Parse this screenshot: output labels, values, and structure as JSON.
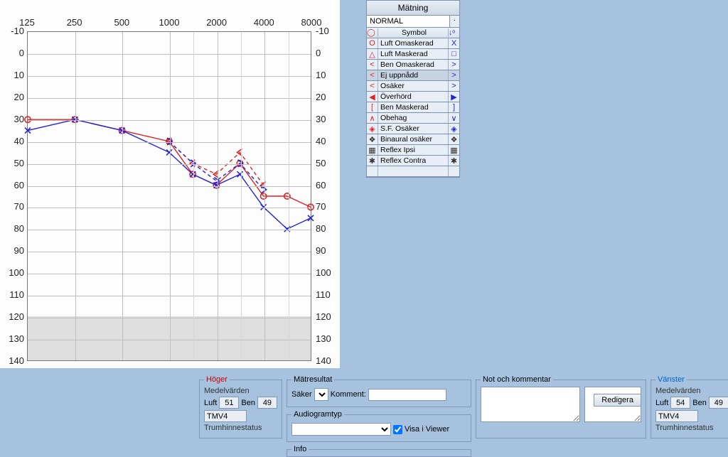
{
  "chart_data": {
    "type": "line",
    "xlabel": "",
    "ylabel": "",
    "x_categories": [
      125,
      250,
      500,
      1000,
      2000,
      4000,
      8000
    ],
    "x_extra_ticks": [
      1500,
      3000,
      6000
    ],
    "y_ticks": [
      -10,
      0,
      10,
      20,
      30,
      40,
      50,
      60,
      70,
      80,
      90,
      100,
      110,
      120,
      130,
      140
    ],
    "ylim": [
      -10,
      140
    ],
    "shaded_from_y": 120,
    "series": [
      {
        "name": "right-air",
        "color": "#d22",
        "marker": "O",
        "points": [
          [
            125,
            30
          ],
          [
            250,
            30
          ],
          [
            500,
            35
          ],
          [
            1000,
            40
          ],
          [
            1500,
            55
          ],
          [
            2000,
            60
          ],
          [
            3000,
            50
          ],
          [
            4000,
            65
          ],
          [
            6000,
            65
          ],
          [
            8000,
            70
          ]
        ]
      },
      {
        "name": "left-air",
        "color": "#22d",
        "marker": "X",
        "points": [
          [
            125,
            35
          ],
          [
            250,
            30
          ],
          [
            500,
            35
          ],
          [
            1000,
            45
          ],
          [
            1500,
            55
          ],
          [
            2000,
            60
          ],
          [
            3000,
            55
          ],
          [
            4000,
            70
          ],
          [
            6000,
            80
          ],
          [
            8000,
            75
          ]
        ]
      },
      {
        "name": "right-bone",
        "color": "#d22",
        "marker": "<",
        "dashed": true,
        "points": [
          [
            1000,
            40
          ],
          [
            1500,
            50
          ],
          [
            2000,
            55
          ],
          [
            3000,
            45
          ],
          [
            4000,
            60
          ]
        ]
      },
      {
        "name": "left-bone",
        "color": "#22d",
        "marker": ">",
        "dashed": true,
        "points": [
          [
            1000,
            40
          ],
          [
            1500,
            50
          ],
          [
            2000,
            58
          ],
          [
            3000,
            50
          ],
          [
            4000,
            62
          ]
        ]
      }
    ]
  },
  "legend": {
    "title": "Mätning",
    "subtitle": "NORMAL",
    "col_header": "Symbol",
    "selected_index": 3,
    "items": [
      {
        "left": "O",
        "label": "Luft Omaskerad",
        "right": "X",
        "lcol": "#d22",
        "rcol": "#22d"
      },
      {
        "left": "△",
        "label": "Luft Maskerad",
        "right": "□",
        "lcol": "#d22",
        "rcol": "#22d"
      },
      {
        "left": "<",
        "label": "Ben Omaskerad",
        "right": ">",
        "lcol": "#d22",
        "rcol": "#22d"
      },
      {
        "left": "<",
        "label": "Ej uppnådd",
        "right": ">",
        "lcol": "#d22",
        "rcol": "#22d"
      },
      {
        "left": "<",
        "label": "Osäker",
        "right": ">",
        "lcol": "#d22",
        "rcol": "#22d"
      },
      {
        "left": "◀",
        "label": "Överhörd",
        "right": "▶",
        "lcol": "#d22",
        "rcol": "#22d"
      },
      {
        "left": "[",
        "label": "Ben Maskerad",
        "right": "]",
        "lcol": "#d22",
        "rcol": "#22d"
      },
      {
        "left": "∧",
        "label": "Obehag",
        "right": "∨",
        "lcol": "#d22",
        "rcol": "#22d"
      },
      {
        "left": "◈",
        "label": "S.F. Osäker",
        "right": "◈",
        "lcol": "#d22",
        "rcol": "#22d"
      },
      {
        "left": "❖",
        "label": "Binaural osäker",
        "right": "❖",
        "lcol": "#333",
        "rcol": "#333"
      },
      {
        "left": "▦",
        "label": "Reflex Ipsi",
        "right": "▦",
        "lcol": "#333",
        "rcol": "#333"
      },
      {
        "left": "✱",
        "label": "Reflex Contra",
        "right": "✱",
        "lcol": "#333",
        "rcol": "#333"
      }
    ]
  },
  "bottom": {
    "hoger": {
      "title": "Höger",
      "medel": "Medelvärden",
      "luft_label": "Luft",
      "luft_value": "51",
      "ben_label": "Ben",
      "ben_value": "49",
      "tmv4": "TMV4",
      "trum": "Trumhinnestatus"
    },
    "mid": {
      "matresultat": "Mätresultat",
      "saker": "Säker",
      "komment": "Komment:",
      "audiogramtyp": "Audiogramtyp",
      "visa": "Visa i Viewer",
      "info": "Info"
    },
    "note": {
      "title": "Not och kommentar",
      "redigera": "Redigera"
    },
    "vanster": {
      "title": "Vänster",
      "medel": "Medelvärden",
      "luft_label": "Luft",
      "luft_value": "54",
      "ben_label": "Ben",
      "ben_value": "49",
      "tmv4": "TMV4",
      "trum": "Trumhinnestatus"
    }
  }
}
